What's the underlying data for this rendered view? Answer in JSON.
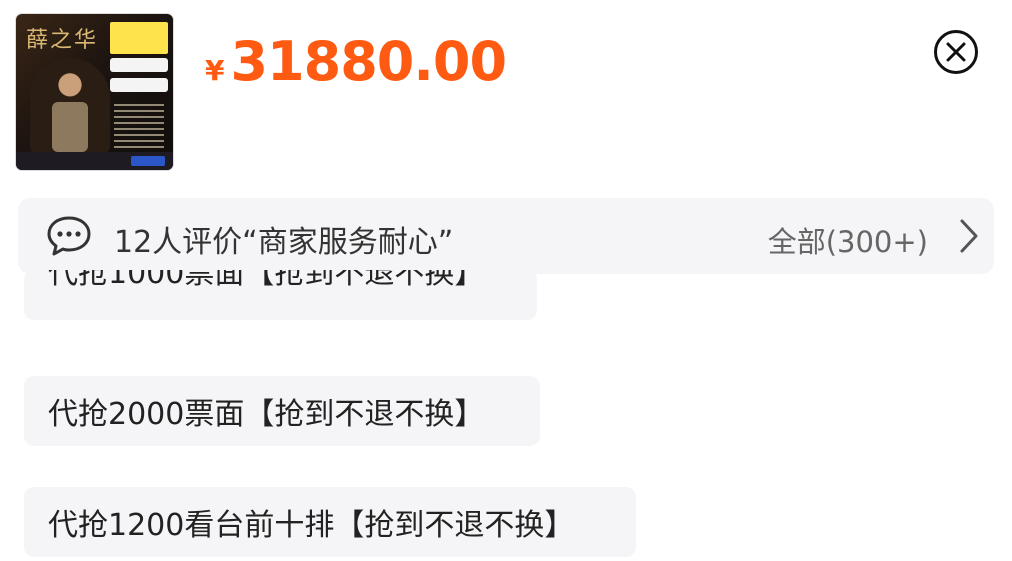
{
  "product": {
    "image_alt": "演唱会海报",
    "currency_symbol": "¥",
    "price": "31880.00"
  },
  "reviews": {
    "summary": "12人评价“商家服务耐心”",
    "all_label": "全部(300+)"
  },
  "options": [
    {
      "label": "代抢1000票面【抢到不退不换】",
      "partially_visible": true
    },
    {
      "label": "代抢2000票面【抢到不退不换】"
    },
    {
      "label": "代抢1200看台前十排【抢到不退不换】"
    }
  ],
  "colors": {
    "price": "#ff5a12",
    "panel_bg": "#f5f5f7"
  },
  "icons": {
    "close": "close-circle-icon",
    "chat": "chat-bubble-icon",
    "chevron": "chevron-right-icon"
  }
}
